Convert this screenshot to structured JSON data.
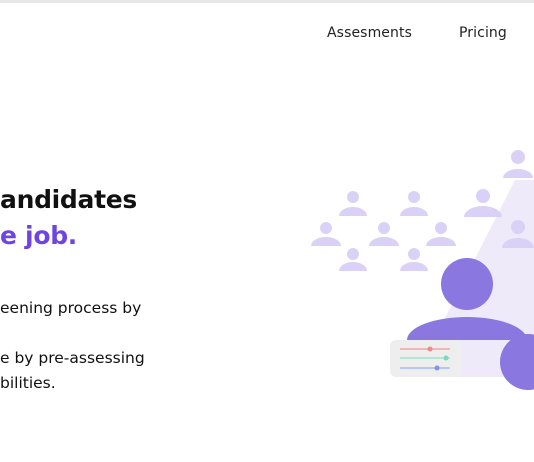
{
  "nav": {
    "items": [
      {
        "label": "Assesments"
      },
      {
        "label": "Pricing"
      }
    ]
  },
  "hero": {
    "headline_line1": "andidates",
    "headline_line2": "e job.",
    "subtext_line1": "eening process by",
    "subtext_line2": "e by pre-assessing",
    "subtext_line3": "bilities."
  },
  "colors": {
    "accent": "#6e45e2",
    "illustration_primary": "#8b77e0",
    "illustration_light": "#d9d2f6",
    "background": "#ffffff"
  },
  "icons": [
    "candidate-crowd-icon",
    "selected-candidate-icon",
    "sliders-card-icon"
  ]
}
